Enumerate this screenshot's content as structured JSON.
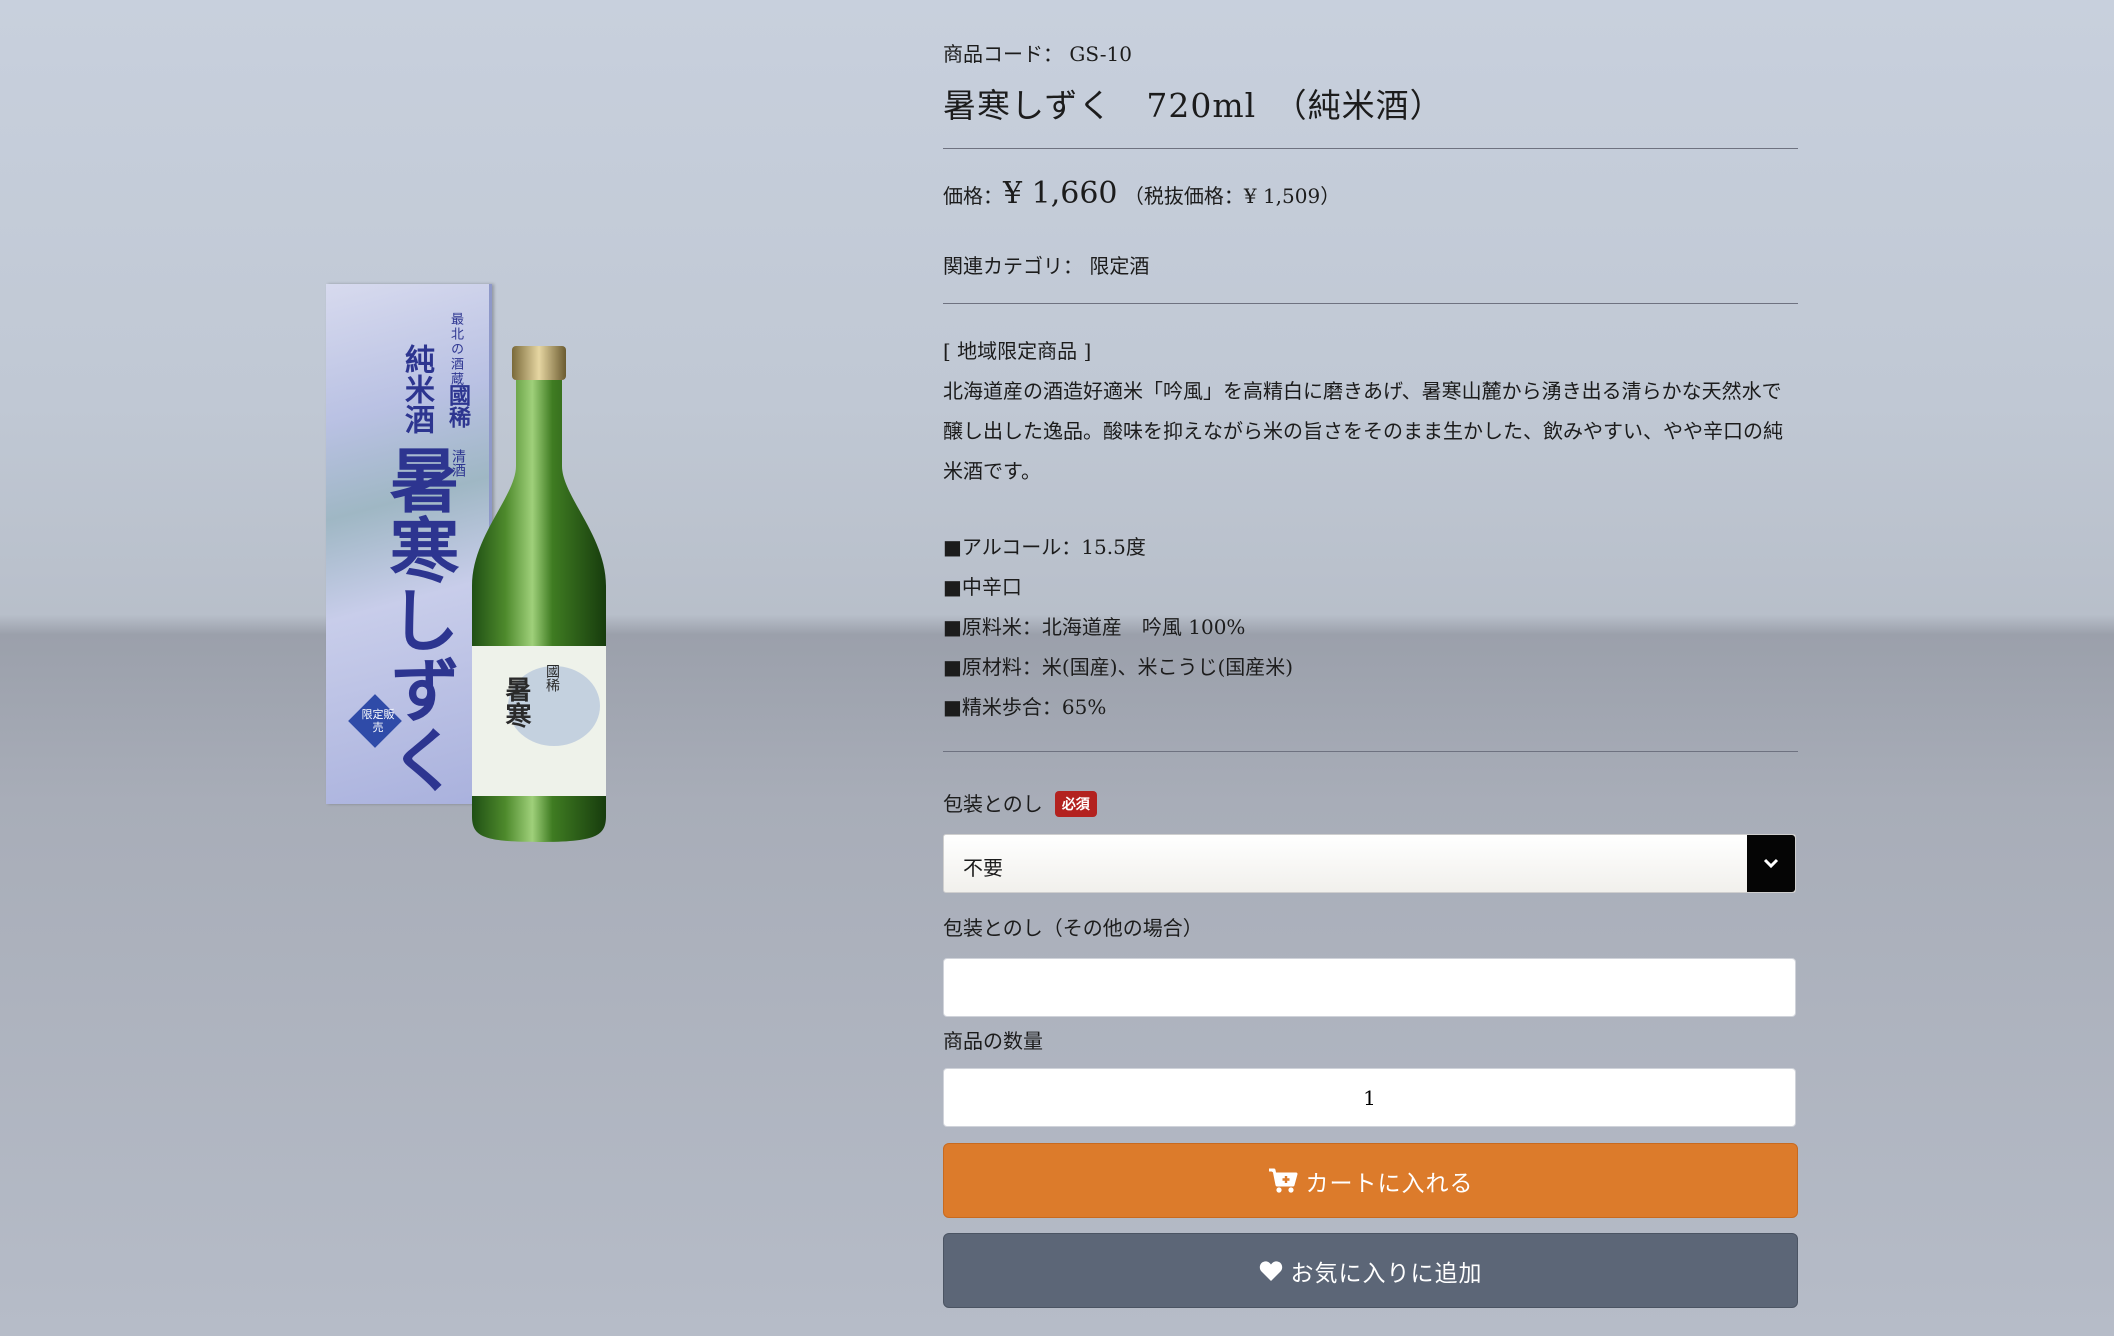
{
  "product": {
    "code_label": "商品コード：",
    "code": "GS-10",
    "title": "暑寒しずく　720ml　（純米酒）",
    "price_label": "価格：",
    "price": "¥ 1,660",
    "price_excl_tax": "（税抜価格：¥ 1,509）",
    "category_label": "関連カテゴリ：",
    "category": "限定酒",
    "description": {
      "tag": "[ 地域限定商品 ]",
      "body": "北海道産の酒造好適米「吟風」を高精白に磨きあげ、暑寒山麓から湧き出る清らかな天然水で醸し出した逸品。酸味を抑えながら米の旨さをそのまま生かした、飲みやすい、やや辛口の純米酒です。"
    },
    "specs": [
      "■アルコール：15.5度",
      "■中辛口",
      "■原料米：北海道産　吟風 100%",
      "■原材料：米(国産)、米こうじ(国産米)",
      "■精米歩合：65%"
    ]
  },
  "image_labels": {
    "box_top": "最北の酒蔵",
    "box_type": "純米酒",
    "box_brand": "國稀",
    "box_seishu": "清酒",
    "box_name": "暑寒しずく",
    "box_badge": "限定販売"
  },
  "form": {
    "wrapping_label": "包装とのし",
    "required_badge": "必須",
    "wrapping_selected": "不要",
    "wrapping_other_label": "包装とのし（その他の場合）",
    "wrapping_other_value": "",
    "quantity_label": "商品の数量",
    "quantity_value": "1"
  },
  "buttons": {
    "add_to_cart": "カートに入れる",
    "add_to_favorites": "お気に入りに追加"
  },
  "colors": {
    "cart_button": "#dc7b2b",
    "favorite_button": "#5c6677",
    "required_badge": "#b3221f"
  },
  "icons": {
    "cart": "cart-icon",
    "heart": "heart-icon",
    "dropdown": "chevron-down-icon"
  }
}
